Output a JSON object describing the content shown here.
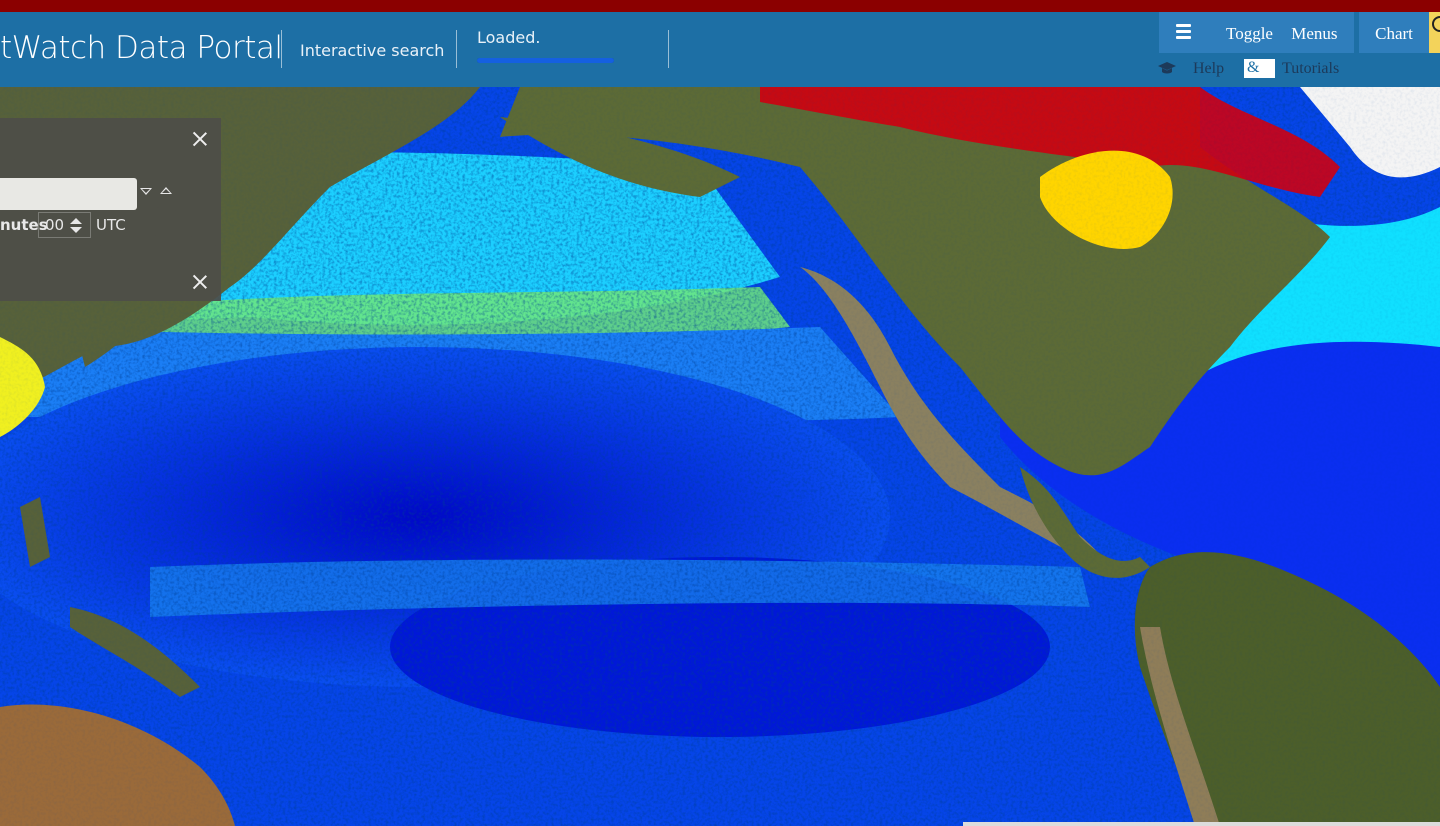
{
  "header": {
    "app_title": "tWatch Data Portal",
    "nav_link": "Interactive search",
    "status_text": "Loaded.",
    "progress_fraction": 1.0,
    "colors": {
      "top_strip": "#8b0000",
      "header_bg": "#1d6fa5",
      "button_bg": "#2f7ebc",
      "accent_yellow": "#f3d35b"
    }
  },
  "toolbar": {
    "toggle_menus_label": "Toggle Menus",
    "toggle_icon": "hamburger-menu-icon",
    "chart_label": "Chart",
    "yellow_button_icon": "lightbulb-icon",
    "help_icon": "graduation-cap-icon",
    "help_label_1": "Help",
    "help_label_amp": "&",
    "help_label_2": "Tutorials"
  },
  "time_panel": {
    "date_value": "",
    "minutes_label": "nutes",
    "minutes_value": "00",
    "timezone_label": "UTC",
    "close_icon": "close-icon",
    "prev_icon": "triangle-down-icon",
    "next_icon": "triangle-up-icon"
  },
  "map": {
    "description": "Ocean chlorophyll concentration overlay on satellite basemap (Pacific / North America)",
    "colorscale": [
      "#00008b",
      "#0000ff",
      "#0a6cf0",
      "#00bfff",
      "#00eaff",
      "#7cfc00",
      "#ffff00",
      "#ffd700",
      "#ff4500",
      "#d00000"
    ]
  }
}
